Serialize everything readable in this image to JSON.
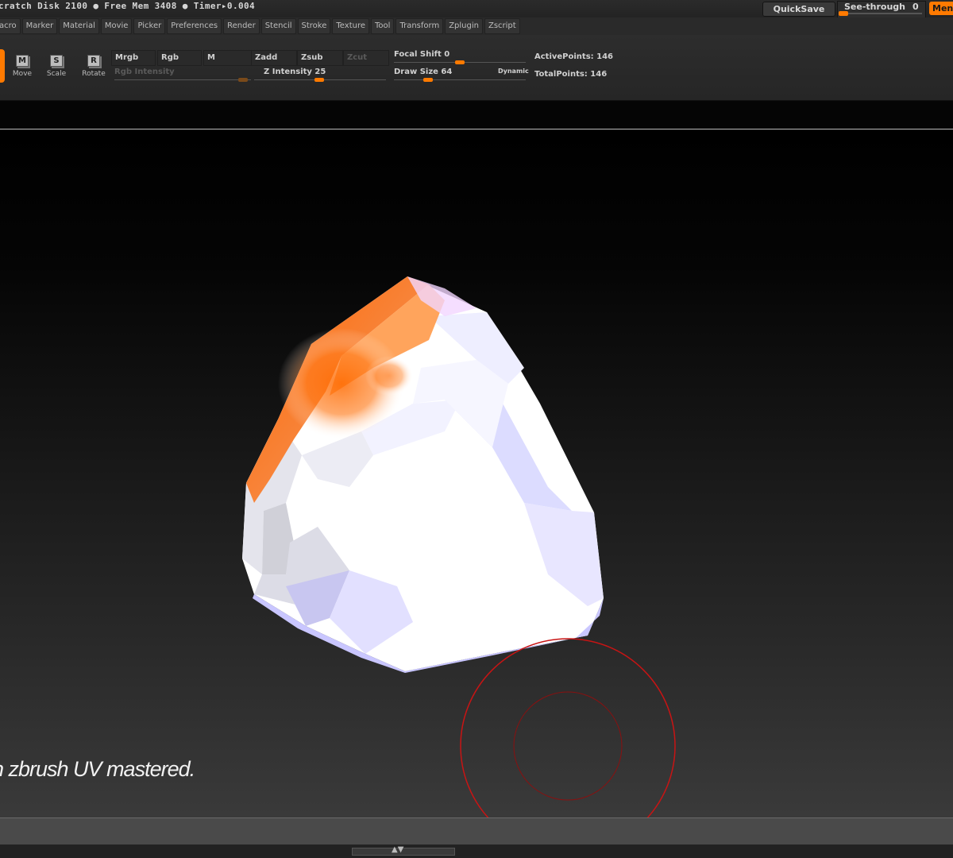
{
  "status": {
    "text": "cratch Disk 2100 ● Free Mem 3408 ● Timer▸0.004",
    "quicksave": "QuickSave",
    "see_through_label": "See-through",
    "see_through_value": "0",
    "see_through_level": 0,
    "menus": "Menus"
  },
  "menu": {
    "items": [
      "acro",
      "Marker",
      "Material",
      "Movie",
      "Picker",
      "Preferences",
      "Render",
      "Stencil",
      "Stroke",
      "Texture",
      "Tool",
      "Transform",
      "Zplugin",
      "Zscript"
    ]
  },
  "tools": {
    "move": "Move",
    "move_glyph": "M",
    "scale": "Scale",
    "scale_glyph": "S",
    "rotate": "Rotate",
    "rotate_glyph": "R"
  },
  "modes": {
    "mrgb": "Mrgb",
    "rgb": "Rgb",
    "m": "M",
    "zadd": "Zadd",
    "zsub": "Zsub",
    "zcut": "Zcut"
  },
  "sliders": {
    "rgb_intensity": "Rgb Intensity",
    "z_intensity": "Z Intensity 25",
    "focal_shift": "Focal Shift 0",
    "draw_size": "Draw Size 64",
    "dynamic": "Dynamic"
  },
  "stats": {
    "active_points": "ActivePoints: 146",
    "total_points": "TotalPoints: 146"
  },
  "caption": "n zbrush UV mastered.",
  "colors": {
    "accent": "#ff7a00",
    "brush_cursor": "#c81414"
  }
}
